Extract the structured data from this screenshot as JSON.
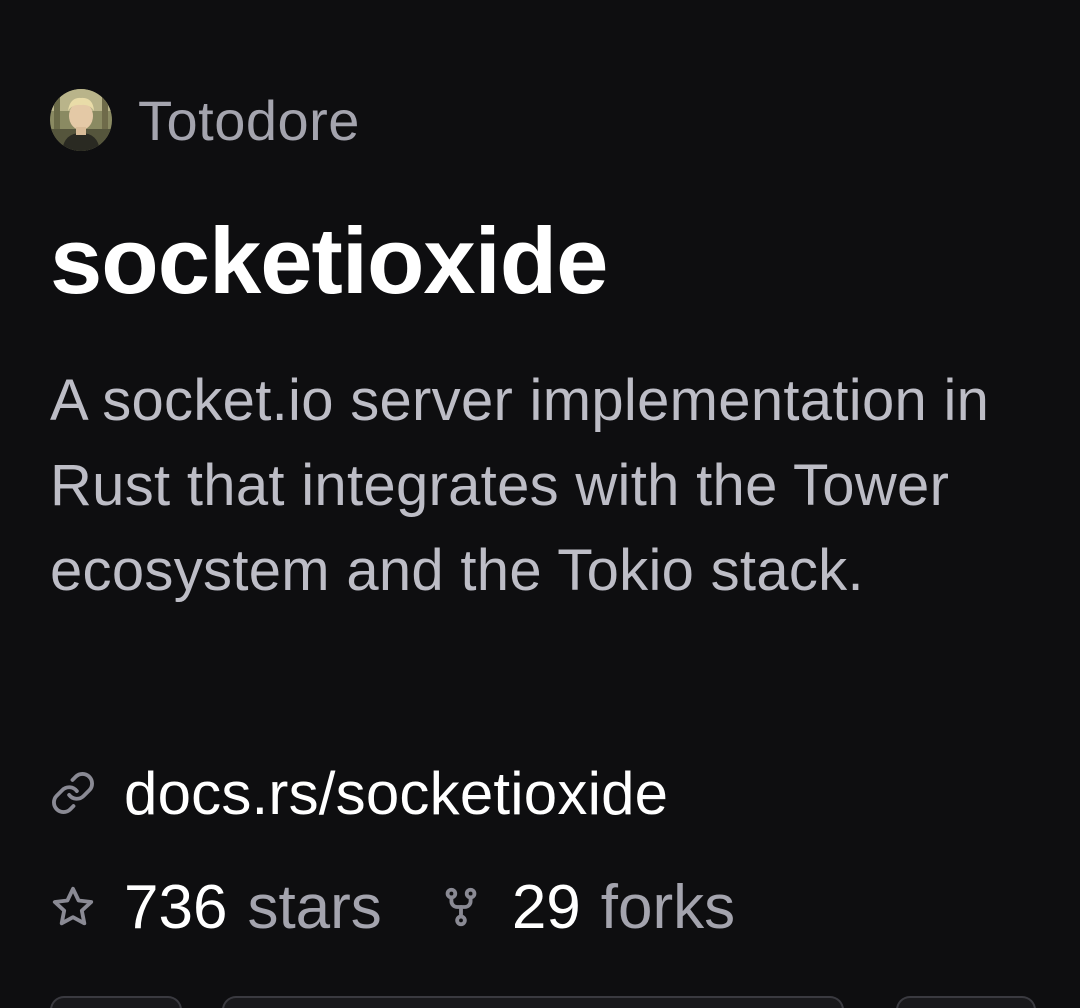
{
  "owner": {
    "name": "Totodore",
    "avatar_icon": "user-avatar"
  },
  "repo": {
    "name": "socketioxide",
    "description": "A socket.io server implementation in Rust that integrates with the Tower ecosystem and the Tokio stack.",
    "website": "docs.rs/socketioxide"
  },
  "stats": {
    "stars_count": "736",
    "stars_label": "stars",
    "forks_count": "29",
    "forks_label": "forks"
  },
  "icons": {
    "link": "link-icon",
    "star": "star-icon",
    "fork": "fork-icon"
  },
  "colors": {
    "background": "#0e0e10",
    "primary_text": "#ffffff",
    "secondary_text": "#a4a4ae",
    "description_text": "#bdbdc6"
  }
}
